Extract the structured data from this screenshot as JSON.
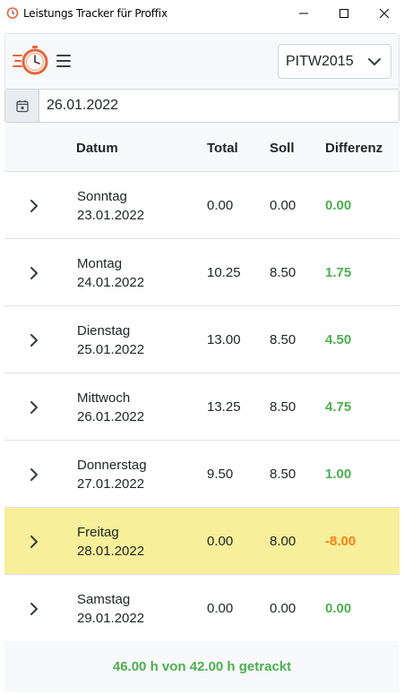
{
  "window": {
    "title": "Leistungs Tracker für Proffix"
  },
  "header": {
    "mandant_selected": "PITW2015"
  },
  "date_filter": {
    "value": "26.01.2022"
  },
  "table": {
    "headers": {
      "datum": "Datum",
      "total": "Total",
      "soll": "Soll",
      "differenz": "Differenz"
    },
    "rows": [
      {
        "day": "Sonntag",
        "date": "23.01.2022",
        "total": "0.00",
        "soll": "0.00",
        "diff": "0.00",
        "diff_color": "#4caf50",
        "highlight": false
      },
      {
        "day": "Montag",
        "date": "24.01.2022",
        "total": "10.25",
        "soll": "8.50",
        "diff": "1.75",
        "diff_color": "#4caf50",
        "highlight": false
      },
      {
        "day": "Dienstag",
        "date": "25.01.2022",
        "total": "13.00",
        "soll": "8.50",
        "diff": "4.50",
        "diff_color": "#4caf50",
        "highlight": false
      },
      {
        "day": "Mittwoch",
        "date": "26.01.2022",
        "total": "13.25",
        "soll": "8.50",
        "diff": "4.75",
        "diff_color": "#4caf50",
        "highlight": false
      },
      {
        "day": "Donnerstag",
        "date": "27.01.2022",
        "total": "9.50",
        "soll": "8.50",
        "diff": "1.00",
        "diff_color": "#4caf50",
        "highlight": false
      },
      {
        "day": "Freitag",
        "date": "28.01.2022",
        "total": "0.00",
        "soll": "8.00",
        "diff": "-8.00",
        "diff_color": "#fd7e14",
        "highlight": true
      },
      {
        "day": "Samstag",
        "date": "29.01.2022",
        "total": "0.00",
        "soll": "0.00",
        "diff": "0.00",
        "diff_color": "#4caf50",
        "highlight": false
      }
    ]
  },
  "footer": {
    "summary": "46.00 h von 42.00 h getrackt"
  },
  "colors": {
    "positive": "#4caf50",
    "negative": "#fd7e14",
    "highlight_row": "#f7ef9a",
    "logo_accent": "#e8643c"
  },
  "icons": {
    "app": "stopwatch-icon",
    "menu": "hamburger-icon",
    "calendar": "calendar-icon",
    "row_expand": "chevron-right-icon",
    "dropdown": "chevron-down-icon"
  }
}
